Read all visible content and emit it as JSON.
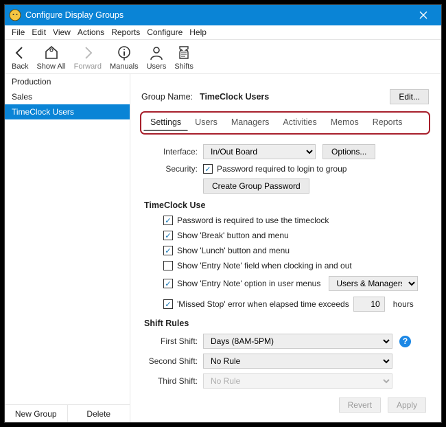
{
  "window": {
    "title": "Configure Display Groups"
  },
  "menus": [
    "File",
    "Edit",
    "View",
    "Actions",
    "Reports",
    "Configure",
    "Help"
  ],
  "toolbar": [
    {
      "label": "Back"
    },
    {
      "label": "Show All"
    },
    {
      "label": "Forward"
    },
    {
      "label": "Manuals"
    },
    {
      "label": "Users"
    },
    {
      "label": "Shifts"
    }
  ],
  "groups": [
    "Production",
    "Sales",
    "TimeClock Users"
  ],
  "sidebar": {
    "new_group": "New Group",
    "delete": "Delete"
  },
  "header": {
    "group_name_label": "Group Name:",
    "group_name_value": "TimeClock Users",
    "edit": "Edit..."
  },
  "tabs": [
    "Settings",
    "Users",
    "Managers",
    "Activities",
    "Memos",
    "Reports"
  ],
  "settings": {
    "interface_label": "Interface:",
    "interface_value": "In/Out Board",
    "options": "Options...",
    "security_label": "Security:",
    "security_login": "Password required to login to group",
    "create_password": "Create Group Password",
    "timeclock_use": "TimeClock Use",
    "chk_password": "Password is required to use the timeclock",
    "chk_break": "Show 'Break' button and menu",
    "chk_lunch": "Show 'Lunch' button and menu",
    "chk_entry_field": "Show 'Entry Note' field when clocking in and out",
    "chk_entry_menu": "Show 'Entry Note' option in user menus",
    "entry_note_audience": "Users & Managers",
    "chk_missed_stop": "'Missed Stop' error when elapsed time exceeds",
    "missed_stop_value": "10",
    "hours_label": "hours",
    "shift_rules": "Shift Rules",
    "first_shift_label": "First Shift:",
    "first_shift_value": "Days (8AM-5PM)",
    "second_shift_label": "Second Shift:",
    "second_shift_value": "No Rule",
    "third_shift_label": "Third Shift:",
    "third_shift_value": "No Rule"
  },
  "footer": {
    "revert": "Revert",
    "apply": "Apply"
  }
}
